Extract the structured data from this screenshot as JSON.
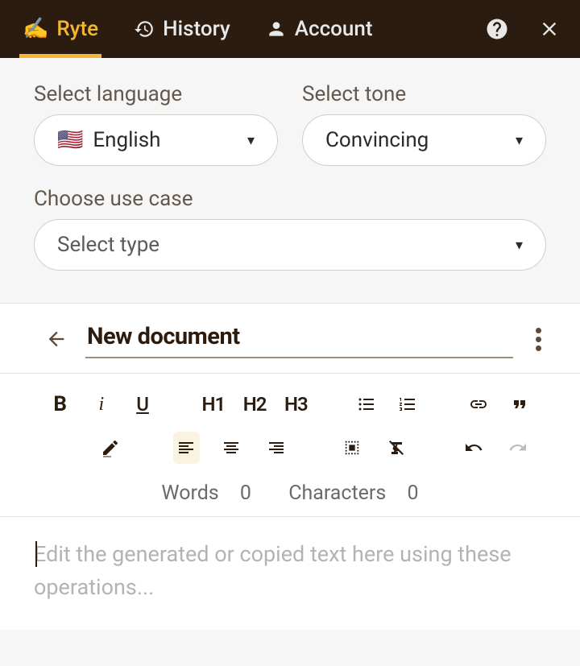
{
  "topbar": {
    "tabs": [
      {
        "label": "Ryte",
        "icon": "write-hand-icon",
        "active": true
      },
      {
        "label": "History",
        "icon": "history-icon",
        "active": false
      },
      {
        "label": "Account",
        "icon": "person-icon",
        "active": false
      }
    ],
    "help_icon": "help-icon",
    "close_icon": "close-icon"
  },
  "config": {
    "language": {
      "label": "Select language",
      "flag": "🇺🇸",
      "value": "English"
    },
    "tone": {
      "label": "Select tone",
      "value": "Convincing"
    },
    "use_case": {
      "label": "Choose use case",
      "placeholder": "Select type"
    }
  },
  "document": {
    "title": "New document",
    "back_icon": "arrow-left-icon",
    "more_icon": "more-vertical-icon"
  },
  "toolbar": {
    "bold": "B",
    "italic": "i",
    "underline": "U",
    "h1": "H1",
    "h2": "H2",
    "h3": "H3",
    "words_label": "Words",
    "words_count": 0,
    "chars_label": "Characters",
    "chars_count": 0
  },
  "editor": {
    "placeholder": "Edit the generated or copied text here using these operations..."
  },
  "colors": {
    "accent": "#f2b632",
    "dark": "#2b1c0f"
  }
}
